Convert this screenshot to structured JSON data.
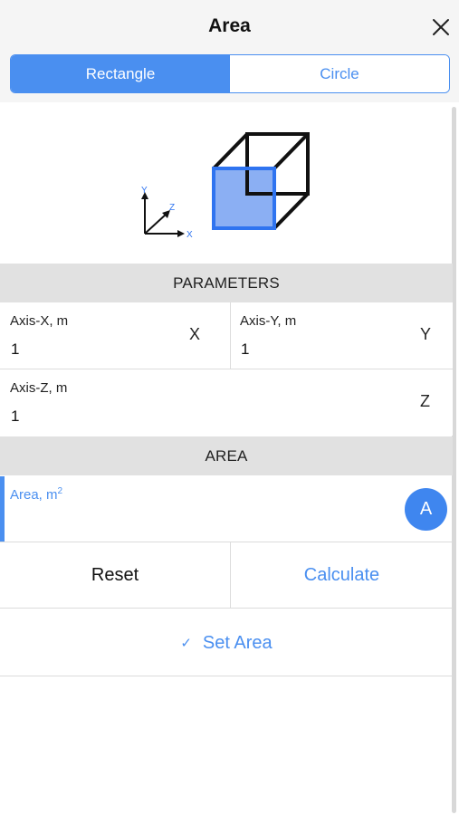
{
  "header": {
    "title": "Area",
    "close_icon": "close-icon"
  },
  "segmented": {
    "active_label": "Rectangle",
    "inactive_label": "Circle"
  },
  "diagram": {
    "axis_y": "Y",
    "axis_z": "Z",
    "axis_x": "X",
    "highlight_color": "#7ea6f2",
    "accent_color": "#2f74f0"
  },
  "parameters": {
    "header": "PARAMETERS",
    "axis_x": {
      "label": "Axis-X, m",
      "value": "1",
      "letter": "X"
    },
    "axis_y": {
      "label": "Axis-Y, m",
      "value": "1",
      "letter": "Y"
    },
    "axis_z": {
      "label": "Axis-Z, m",
      "value": "1",
      "letter": "Z"
    }
  },
  "area": {
    "header": "AREA",
    "label": "Area, m",
    "label_sup": "2",
    "value": "",
    "circle_label": "A"
  },
  "actions": {
    "reset": "Reset",
    "calculate": "Calculate",
    "set_area": "Set Area",
    "set_area_icon": "✓"
  },
  "colors": {
    "accent": "#4a8ff0",
    "section_bg": "#e1e1e1"
  }
}
